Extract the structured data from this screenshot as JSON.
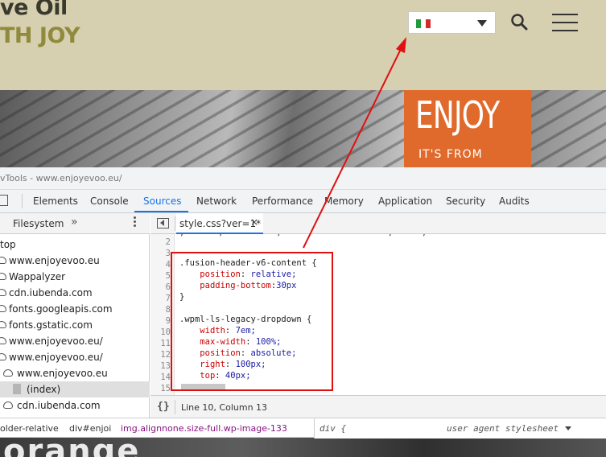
{
  "site": {
    "logo_line1": "ve Oil",
    "logo_line2": "TH JOY",
    "banner_text": "ENJOY",
    "banner_sub": "IT'S FROM",
    "bottom_text": "orange",
    "colors": {
      "header_bg": "#d6cfb0",
      "banner": "#e06a2c",
      "logo_accent": "#8f8a3c"
    },
    "language_flag": "flag-italy-icon"
  },
  "devtools": {
    "title": "vTools - www.enjoyevoo.eu/",
    "tabs": [
      "Elements",
      "Console",
      "Sources",
      "Network",
      "Performance",
      "Memory",
      "Application",
      "Security",
      "Audits"
    ],
    "active_tab": "Sources",
    "navigator": {
      "tab_label": "Filesystem",
      "more": "»",
      "tree": [
        {
          "label": "top",
          "depth": 0,
          "icon": "none"
        },
        {
          "label": "www.enjoyevoo.eu",
          "depth": 0,
          "icon": "cloud-icon"
        },
        {
          "label": "Wappalyzer",
          "depth": 0,
          "icon": "cloud-icon"
        },
        {
          "label": "cdn.iubenda.com",
          "depth": 0,
          "icon": "cloud-icon"
        },
        {
          "label": "fonts.googleapis.com",
          "depth": 0,
          "icon": "cloud-icon"
        },
        {
          "label": "fonts.gstatic.com",
          "depth": 0,
          "icon": "cloud-icon"
        },
        {
          "label": "www.enjoyevoo.eu/",
          "depth": 0,
          "icon": "cloud-icon"
        },
        {
          "label": "www.enjoyevoo.eu/",
          "depth": 0,
          "icon": "cloud-icon"
        },
        {
          "label": "www.enjoyevoo.eu",
          "depth": 1,
          "icon": "cloud-icon"
        },
        {
          "label": "(index)",
          "depth": 2,
          "icon": "file-icon",
          "selected": true
        },
        {
          "label": "cdn.iubenda.com",
          "depth": 0,
          "icon": "cloud-icon"
        }
      ]
    },
    "editor": {
      "file_tab": "style.css?ver=1*",
      "close": "×",
      "line_numbers": [
        "2",
        "3",
        "4",
        "5",
        "6",
        "7",
        "8",
        "9",
        "10",
        "11",
        "12",
        "13",
        "14",
        "15"
      ],
      "lines": [
        {
          "selector": ""
        },
        {
          "selector": ".fusion-header-v6-content {"
        },
        {
          "prop": "position",
          "value": "relative;"
        },
        {
          "prop": "padding-bottom",
          "value": "30px"
        },
        {
          "selector": "}"
        },
        {
          "selector": ""
        },
        {
          "selector": ".wpml-ls-legacy-dropdown {"
        },
        {
          "prop": "width",
          "value": "7em;"
        },
        {
          "prop": "max-width",
          "value": "100%;"
        },
        {
          "prop": "position",
          "value": "absolute;"
        },
        {
          "prop": "right",
          "value": "100px;"
        },
        {
          "prop": "top",
          "value": "40px;"
        },
        {
          "selector": ""
        },
        {
          "selector": ""
        }
      ],
      "partial_top_line": ",       ,           ,                      ,      ,",
      "status_braces": "{}",
      "cursor_position": "Line 10, Column 13"
    },
    "elements_breadcrumb": [
      "older-relative",
      "div#enjoi",
      "img.alignnone.size-full.wp-image-133"
    ],
    "styles": {
      "selector": "div {",
      "source": "user agent stylesheet"
    }
  },
  "annotation": {
    "box_color": "#e01010"
  }
}
